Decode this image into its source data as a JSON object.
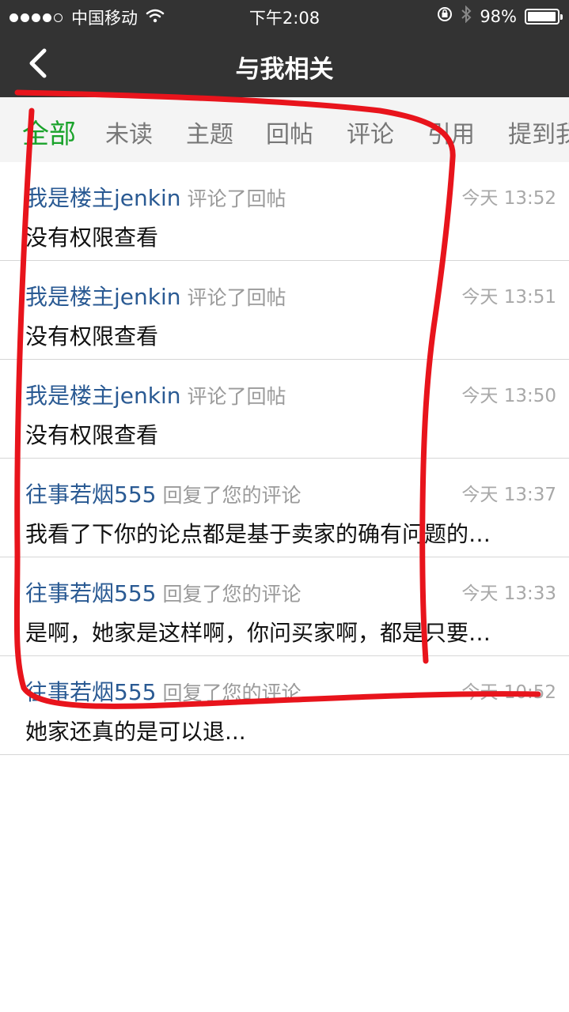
{
  "status_bar": {
    "signal": "●●●●○",
    "carrier": "中国移动",
    "time": "下午2:08",
    "battery": "98%",
    "battery_level": 0.98
  },
  "nav": {
    "back_icon": "chevron-left-icon",
    "title": "与我相关"
  },
  "tabs": [
    {
      "label": "全部",
      "active": true
    },
    {
      "label": "未读"
    },
    {
      "label": "主题"
    },
    {
      "label": "回帖"
    },
    {
      "label": "评论"
    },
    {
      "label": "引用"
    },
    {
      "label": "提到我"
    }
  ],
  "items": [
    {
      "user": "我是楼主jenkin",
      "action": "评论了回帖",
      "time": "今天 13:52",
      "content": "没有权限查看"
    },
    {
      "user": "我是楼主jenkin",
      "action": "评论了回帖",
      "time": "今天 13:51",
      "content": "没有权限查看"
    },
    {
      "user": "我是楼主jenkin",
      "action": "评论了回帖",
      "time": "今天 13:50",
      "content": "没有权限查看"
    },
    {
      "user": "往事若烟555",
      "action": "回复了您的评论",
      "time": "今天 13:37",
      "content": "我看了下你的论点都是基于卖家的确有问题的…"
    },
    {
      "user": "往事若烟555",
      "action": "回复了您的评论",
      "time": "今天 13:33",
      "content": "是啊，她家是这样啊，你问买家啊，都是只要…"
    },
    {
      "user": "往事若烟555",
      "action": "回复了您的评论",
      "time": "今天 10:52",
      "content": "她家还真的是可以退..."
    }
  ],
  "colors": {
    "header_bg": "#333333",
    "active_tab": "#1aa32b",
    "username": "#2a5a93",
    "annotation": "#e8141c"
  }
}
